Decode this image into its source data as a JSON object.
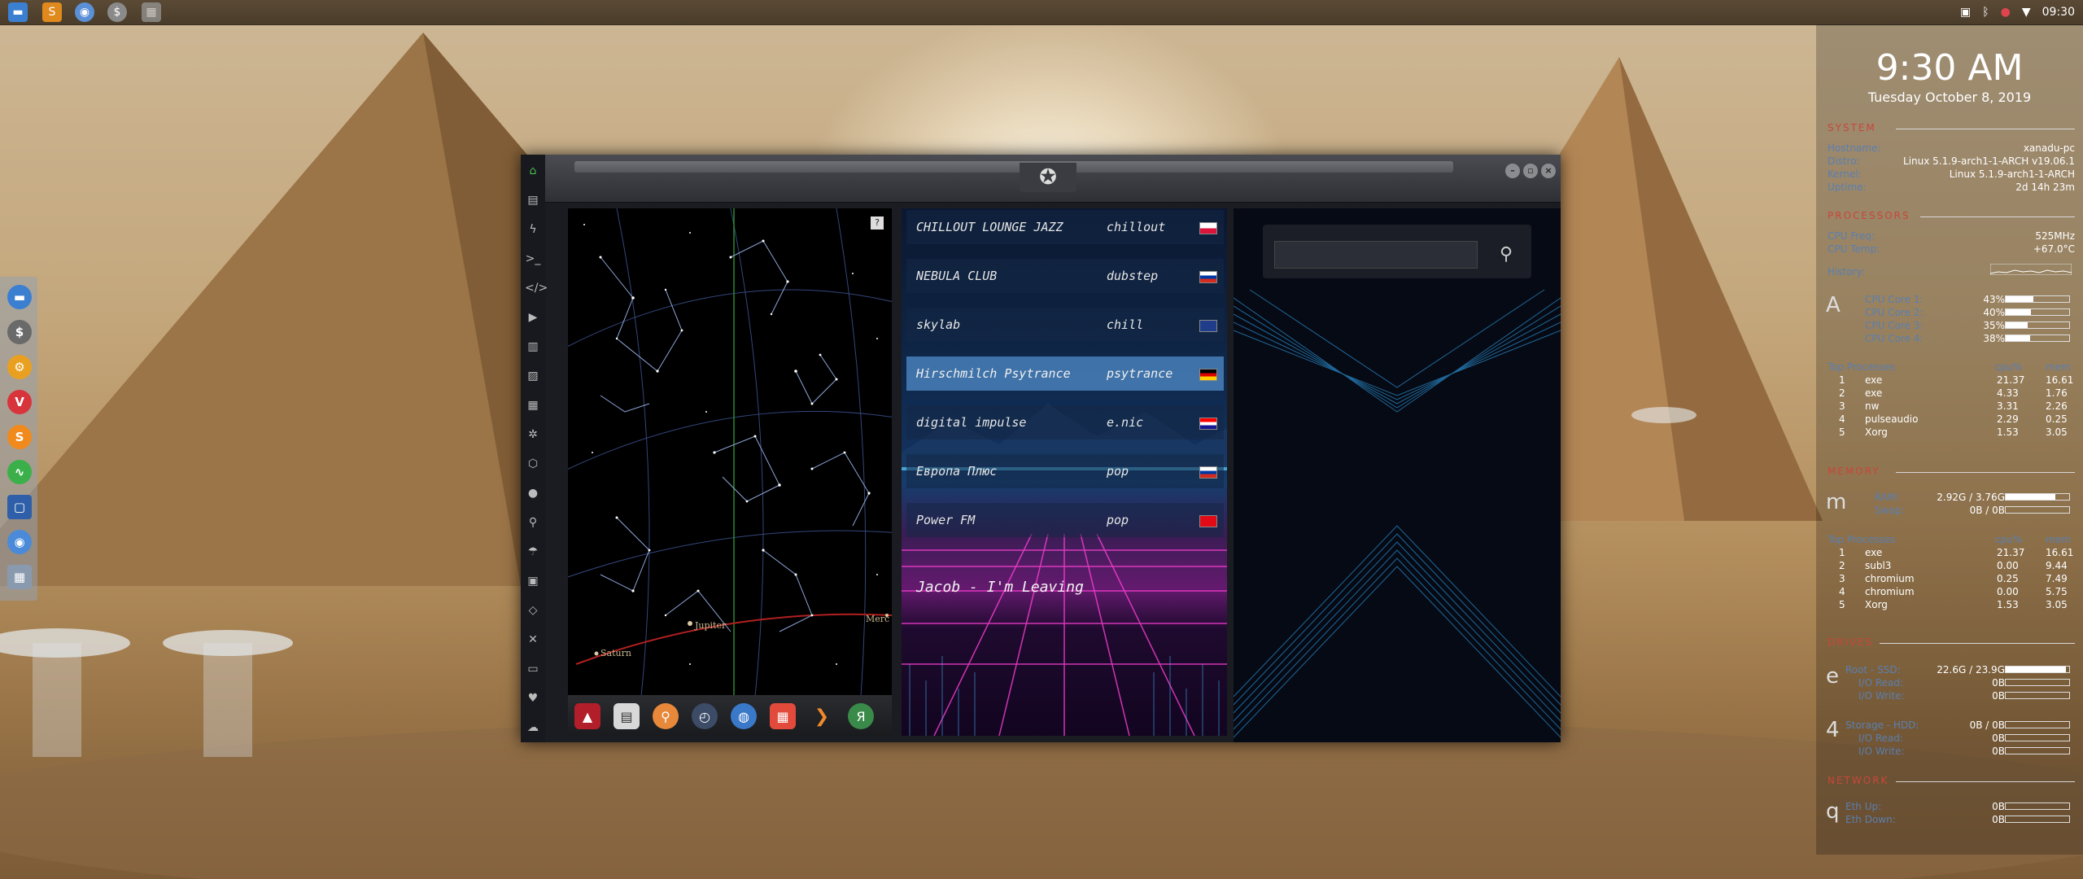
{
  "top_panel": {
    "launchers": [
      "file-manager-icon",
      "sublime-icon",
      "chrome-icon",
      "terminal-icon",
      "workspace-icon"
    ],
    "tray": [
      "image-icon",
      "bluetooth-icon",
      "notification-icon",
      "wifi-icon"
    ],
    "time": "09:30"
  },
  "dock": {
    "items": [
      "file-manager-icon",
      "terminal-icon",
      "settings-icon",
      "vivaldi-icon",
      "sublime-icon",
      "monitor-icon",
      "screenshot-icon",
      "chromium-icon",
      "apps-grid-icon"
    ]
  },
  "window": {
    "sidebar_icons": [
      "home-icon",
      "file-icon",
      "bolt-icon",
      "terminal-icon",
      "code-icon",
      "play-icon",
      "document-icon",
      "image-icon",
      "news-icon",
      "settings-icon",
      "hexagon-icon",
      "globe-icon",
      "search-icon",
      "umbrella-icon",
      "contacts-icon",
      "share-icon",
      "fullscreen-icon",
      "youtube-icon",
      "heart-icon",
      "cloud-icon"
    ],
    "emblem": "rebel-alliance-icon",
    "starmap": {
      "help_label": "?",
      "planets": [
        {
          "name": "Jupiter"
        },
        {
          "name": "Saturn"
        },
        {
          "name": "Merc"
        }
      ]
    },
    "launcher_icons": [
      "arch-icon",
      "calendar-icon",
      "search-icon",
      "clock-icon",
      "globe-icon",
      "calendar2-icon",
      "play-icon",
      "yandex-icon"
    ],
    "radio": {
      "stations": [
        {
          "name": "CHILLOUT LOUNGE JAZZ",
          "genre": "chillout",
          "flag": "pl"
        },
        {
          "name": "NEBULA CLUB",
          "genre": "dubstep",
          "flag": "ru"
        },
        {
          "name": "skylab",
          "genre": "chill",
          "flag": "gb"
        },
        {
          "name": "Hirschmilch Psytrance",
          "genre": "psytrance",
          "flag": "de",
          "selected": true
        },
        {
          "name": "digital impulse",
          "genre": "e.nic",
          "flag": "hr"
        },
        {
          "name": "Европа Плюс",
          "genre": "pop",
          "flag": "ru"
        },
        {
          "name": "Power FM",
          "genre": "pop",
          "flag": "tr"
        }
      ],
      "now_playing": "Jacob - I'm Leaving"
    },
    "search": {
      "placeholder": "",
      "value": ""
    }
  },
  "conky": {
    "clock": "9:30 AM",
    "date": "Tuesday October 8, 2019",
    "system": {
      "header": "SYSTEM",
      "rows": [
        {
          "label": "Hostname:",
          "value": "xanadu-pc"
        },
        {
          "label": "Distro:",
          "value": "Linux 5.1.9-arch1-1-ARCH v19.06.1"
        },
        {
          "label": "Kernel:",
          "value": "Linux 5.1.9-arch1-1-ARCH"
        },
        {
          "label": "Uptime:",
          "value": "2d 14h 23m"
        }
      ]
    },
    "processors": {
      "header": "PROCESSORS",
      "freq_label": "CPU Freq:",
      "freq": "525MHz",
      "temp_label": "CPU Temp:",
      "temp": "+67.0°C",
      "history_label": "History:",
      "cores": [
        {
          "label": "CPU Core 1:",
          "pct": 43,
          "value": "43%"
        },
        {
          "label": "CPU Core 2:",
          "pct": 40,
          "value": "40%"
        },
        {
          "label": "CPU Core 3:",
          "pct": 35,
          "value": "35%"
        },
        {
          "label": "CPU Core 4:",
          "pct": 38,
          "value": "38%"
        }
      ],
      "top_title": "Top Processes",
      "col_cpu": "cpu%",
      "col_mem": "mem",
      "top": [
        {
          "rank": "1",
          "name": "exe",
          "cpu": "21.37",
          "mem": "16.61"
        },
        {
          "rank": "2",
          "name": "exe",
          "cpu": "4.33",
          "mem": "1.76"
        },
        {
          "rank": "3",
          "name": "nw",
          "cpu": "3.31",
          "mem": "2.26"
        },
        {
          "rank": "4",
          "name": "pulseaudio",
          "cpu": "2.29",
          "mem": "0.25"
        },
        {
          "rank": "5",
          "name": "Xorg",
          "cpu": "1.53",
          "mem": "3.05"
        }
      ]
    },
    "memory": {
      "header": "MEMORY",
      "ram_label": "RAM:",
      "ram": "2.92G / 3.76G",
      "ram_pct": 78,
      "swap_label": "Swap:",
      "swap": "0B / 0B",
      "swap_pct": 0,
      "top_title": "Top Processes",
      "col_cpu": "cpu%",
      "col_mem": "mem",
      "top": [
        {
          "rank": "1",
          "name": "exe",
          "cpu": "21.37",
          "mem": "16.61"
        },
        {
          "rank": "2",
          "name": "subl3",
          "cpu": "0.00",
          "mem": "9.44"
        },
        {
          "rank": "3",
          "name": "chromium",
          "cpu": "0.25",
          "mem": "7.49"
        },
        {
          "rank": "4",
          "name": "chromium",
          "cpu": "0.00",
          "mem": "5.75"
        },
        {
          "rank": "5",
          "name": "Xorg",
          "cpu": "1.53",
          "mem": "3.05"
        }
      ]
    },
    "drives": {
      "header": "DRIVES",
      "root_label": "Root - SSD:",
      "root": "22.6G / 23.9G",
      "root_pct": 95,
      "root_read_label": "I/O Read:",
      "root_read": "0B",
      "root_write_label": "I/O Write:",
      "root_write": "0B",
      "storage_label": "Storage - HDD:",
      "storage": "0B / 0B",
      "storage_pct": 0,
      "storage_read_label": "I/O Read:",
      "storage_read": "0B",
      "storage_write_label": "I/O Write:",
      "storage_write": "0B"
    },
    "network": {
      "header": "NETWORK",
      "up_label": "Eth Up:",
      "up": "0B",
      "down_label": "Eth Down:",
      "down": "0B"
    },
    "glyphs": {
      "processors": "A",
      "memory": "m",
      "drives": "e",
      "storage": "4",
      "network": "q"
    }
  }
}
